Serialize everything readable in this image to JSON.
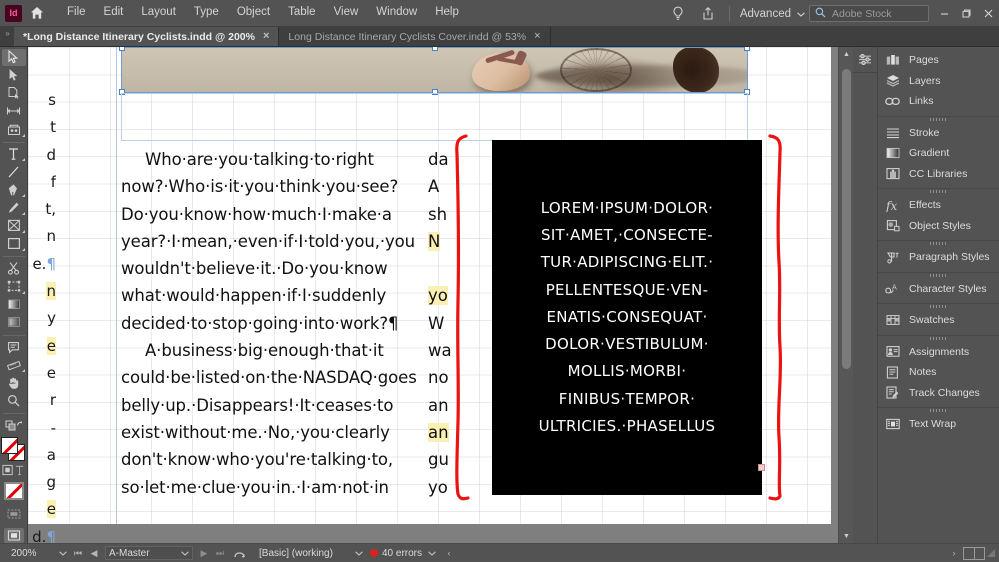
{
  "app": {
    "logo_text": "Id",
    "workspace": "Advanced",
    "stock_placeholder": "Adobe Stock",
    "icons": {
      "home": "home-icon",
      "hint": "lightbulb-icon",
      "share": "share-icon",
      "search": "search-icon",
      "minimize": "minimize-icon",
      "restore": "restore-icon",
      "close": "close-icon"
    }
  },
  "menubar": {
    "items": [
      {
        "label": "File"
      },
      {
        "label": "Edit"
      },
      {
        "label": "Layout"
      },
      {
        "label": "Type"
      },
      {
        "label": "Object"
      },
      {
        "label": "Table"
      },
      {
        "label": "View"
      },
      {
        "label": "Window"
      },
      {
        "label": "Help"
      }
    ]
  },
  "tabs": [
    {
      "label": "*Long Distance Itinerary Cyclists.indd @ 200%",
      "close": "×",
      "active": true
    },
    {
      "label": "Long Distance Itinerary Cyclists Cover.indd @ 53%",
      "close": "×",
      "active": false
    }
  ],
  "toolbar": {
    "tools": [
      {
        "name": "selection-tool",
        "selected": true
      },
      {
        "name": "direct-selection-tool",
        "selected": false
      },
      {
        "name": "page-tool",
        "selected": false
      },
      {
        "name": "gap-tool",
        "selected": false
      },
      {
        "name": "content-collector-tool",
        "selected": false
      },
      {
        "name": "type-tool",
        "selected": false
      },
      {
        "name": "line-tool",
        "selected": false
      },
      {
        "name": "pen-tool",
        "selected": false
      },
      {
        "name": "pencil-tool",
        "selected": false
      },
      {
        "name": "frame-tool",
        "selected": false
      },
      {
        "name": "rectangle-tool",
        "selected": false
      },
      {
        "name": "scissors-tool",
        "selected": false
      },
      {
        "name": "free-transform-tool",
        "selected": false
      },
      {
        "name": "gradient-swatch-tool",
        "selected": false
      },
      {
        "name": "gradient-feather-tool",
        "selected": false
      },
      {
        "name": "note-tool",
        "selected": false
      },
      {
        "name": "measure-tool",
        "selected": false
      },
      {
        "name": "hand-tool",
        "selected": false
      },
      {
        "name": "zoom-tool",
        "selected": false
      }
    ]
  },
  "document": {
    "left_column_cutoff": [
      {
        "text": "s",
        "highlight": false,
        "pilcrow": false
      },
      {
        "text": "t",
        "highlight": false,
        "pilcrow": false
      },
      {
        "text": "d",
        "highlight": false,
        "pilcrow": false
      },
      {
        "text": "f",
        "highlight": false,
        "pilcrow": false
      },
      {
        "text": "t,",
        "highlight": false,
        "pilcrow": false
      },
      {
        "text": "n",
        "highlight": false,
        "pilcrow": false
      },
      {
        "text": "e.",
        "highlight": false,
        "pilcrow": true
      },
      {
        "text": "n",
        "highlight": true,
        "pilcrow": false
      },
      {
        "text": "y",
        "highlight": false,
        "pilcrow": false
      },
      {
        "text": "e",
        "highlight": true,
        "pilcrow": false
      },
      {
        "text": "e",
        "highlight": false,
        "pilcrow": false
      },
      {
        "text": "r",
        "highlight": false,
        "pilcrow": false
      },
      {
        "text": "-",
        "highlight": false,
        "pilcrow": false
      },
      {
        "text": "a",
        "highlight": false,
        "pilcrow": false
      },
      {
        "text": "g",
        "highlight": false,
        "pilcrow": false
      },
      {
        "text": "e",
        "highlight": true,
        "pilcrow": false
      },
      {
        "text": "d.",
        "highlight": false,
        "pilcrow": true
      }
    ],
    "image_alt": "photo-sandaled-feet-on-pavement-with-bicycle-shadow",
    "body_lines": [
      {
        "text": "Who·are·you·talking·to·right",
        "indent": true
      },
      {
        "text": "now?·Who·is·it·you·think·you·see?",
        "indent": false
      },
      {
        "text": "Do·you·know·how·much·I·make·a",
        "indent": false
      },
      {
        "text": "year?·I·mean,·even·if·I·told·you,·you",
        "indent": false
      },
      {
        "text": "wouldn't·believe·it.·Do·you·know",
        "indent": false
      },
      {
        "text": "what·would·happen·if·I·suddenly",
        "indent": false
      },
      {
        "text": "decided·to·stop·going·into·work?¶",
        "indent": false
      },
      {
        "text": "A·business·big·enough·that·it",
        "indent": true
      },
      {
        "text": "could·be·listed·on·the·NASDAQ·goes",
        "indent": false
      },
      {
        "text": "belly·up.·Disappears!·It·ceases·to",
        "indent": false
      },
      {
        "text": "exist·without·me.·No,·you·clearly",
        "indent": false
      },
      {
        "text": "don't·know·who·you're·talking·to,",
        "indent": false
      },
      {
        "text": "so·let·me·clue·you·in.·I·am·not·in",
        "indent": false
      }
    ],
    "right_column_lines": [
      {
        "text": "da",
        "highlight": false
      },
      {
        "text": "A",
        "highlight": false
      },
      {
        "text": "sh",
        "highlight": false
      },
      {
        "text": "N",
        "highlight": true
      },
      {
        "text": "",
        "highlight": false
      },
      {
        "text": "yo",
        "highlight": true
      },
      {
        "text": "W",
        "highlight": false
      },
      {
        "text": "wa",
        "highlight": false
      },
      {
        "text": "no",
        "highlight": false
      },
      {
        "text": "an",
        "highlight": false
      },
      {
        "text": "an",
        "highlight": true
      },
      {
        "text": "gu",
        "highlight": false
      },
      {
        "text": "yo",
        "highlight": false
      }
    ],
    "black_box_lines": [
      "LOREM·IPSUM·DOLOR·",
      "SIT·AMET,·CONSECTE-",
      "TUR·ADIPISCING·ELIT.·",
      "PELLENTESQUE·VEN-",
      "ENATIS·CONSEQUAT·",
      "DOLOR·VESTIBULUM·",
      "MOLLIS·MORBI·",
      "FINIBUS·TEMPOR·",
      "ULTRICIES.·PHASELLUS"
    ],
    "annotation_color": "#ee1111",
    "highlight_color": "#fbf0b4"
  },
  "panels": {
    "groups": [
      {
        "items": [
          {
            "label": "Pages",
            "icon": "pages-icon"
          },
          {
            "label": "Layers",
            "icon": "layers-icon"
          },
          {
            "label": "Links",
            "icon": "links-icon"
          }
        ]
      },
      {
        "items": [
          {
            "label": "Stroke",
            "icon": "stroke-icon"
          },
          {
            "label": "Gradient",
            "icon": "gradient-icon"
          },
          {
            "label": "CC Libraries",
            "icon": "cc-libraries-icon"
          }
        ]
      },
      {
        "items": [
          {
            "label": "Effects",
            "icon": "effects-icon"
          },
          {
            "label": "Object Styles",
            "icon": "object-styles-icon"
          }
        ]
      },
      {
        "items": [
          {
            "label": "Paragraph Styles",
            "icon": "paragraph-styles-icon"
          }
        ]
      },
      {
        "items": [
          {
            "label": "Character Styles",
            "icon": "character-styles-icon"
          }
        ]
      },
      {
        "items": [
          {
            "label": "Swatches",
            "icon": "swatches-icon"
          }
        ]
      },
      {
        "items": [
          {
            "label": "Assignments",
            "icon": "assignments-icon"
          },
          {
            "label": "Notes",
            "icon": "notes-icon"
          },
          {
            "label": "Track Changes",
            "icon": "track-changes-icon"
          }
        ]
      },
      {
        "items": [
          {
            "label": "Text Wrap",
            "icon": "text-wrap-icon"
          }
        ]
      }
    ]
  },
  "statusbar": {
    "zoom": "200%",
    "master_page": "A-Master",
    "preflight_profile": "[Basic] (working)",
    "errors": "40 errors",
    "error_color": "#e02020"
  }
}
